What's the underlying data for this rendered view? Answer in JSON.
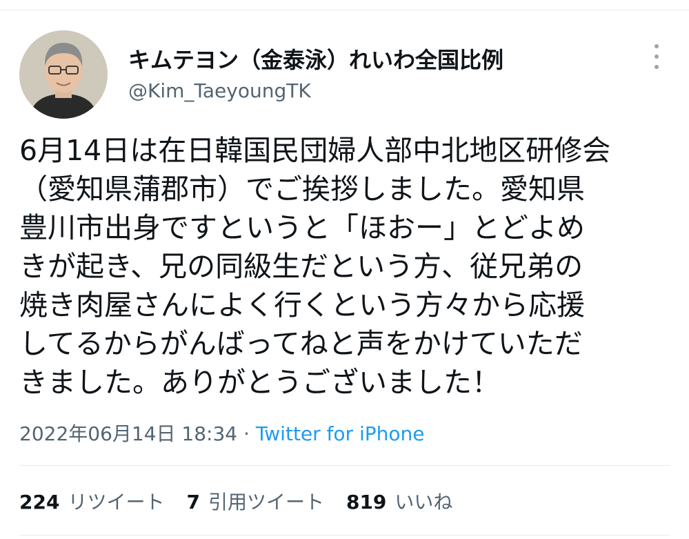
{
  "user": {
    "display_name": "キムテヨン（金泰泳）れいわ全国比例",
    "handle": "@Kim_TaeyoungTK"
  },
  "tweet": {
    "lines": [
      "6月14日は在日韓国民団婦人部中北地区研修会",
      "（愛知県蒲郡市）でご挨拶しました。愛知県",
      "豊川市出身ですというと「ほおー」とどよめ",
      "きが起き、兄の同級生だという方、従兄弟の",
      "焼き肉屋さんによく行くという方々から応援",
      "してるからがんばってねと声をかけていただ",
      "きました。ありがとうございました！"
    ]
  },
  "meta": {
    "datetime": "2022年06月14日 18:34",
    "separator": " · ",
    "source": "Twitter for iPhone"
  },
  "stats": {
    "retweets_count": "224",
    "retweets_label": "リツイート",
    "quotes_count": "7",
    "quotes_label": "引用ツイート",
    "likes_count": "819",
    "likes_label": "いいね"
  },
  "colors": {
    "text": "#0f1419",
    "secondary": "#536471",
    "link": "#1d9bf0",
    "divider": "#e6ecf0"
  },
  "icons": {
    "more": "more-vertical-icon"
  }
}
